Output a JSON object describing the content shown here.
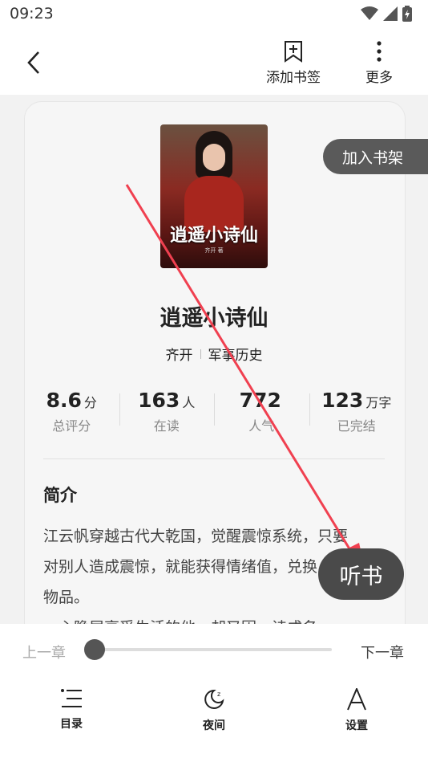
{
  "status_bar": {
    "time": "09:23",
    "icons": [
      "wifi-icon",
      "signal-icon",
      "battery-charging-icon"
    ]
  },
  "top_bar": {
    "back_icon": "chevron-left-icon",
    "bookmark_label": "添加书签",
    "more_label": "更多"
  },
  "book": {
    "cover_title": "逍遥小诗仙",
    "cover_author": "齐开 著",
    "title": "逍遥小诗仙",
    "author": "齐开",
    "category": "军事历史"
  },
  "shelf_button": "加入书架",
  "stats": [
    {
      "value": "8.6",
      "unit": "分",
      "caption": "总评分"
    },
    {
      "value": "163",
      "unit": "人",
      "caption": "在读"
    },
    {
      "value": "772",
      "unit": "",
      "caption": "人气"
    },
    {
      "value": "123",
      "unit": "万字",
      "caption": "已完结"
    }
  ],
  "intro": {
    "heading": "简介",
    "lines": [
      "江云帆穿越古代大乾国，觉醒震惊系统，只要",
      "对别人造成震惊，就能获得情绪值，兑换",
      "物品。",
      "一心隐居享受生活的他，却又因一诗成名"
    ]
  },
  "listen_button": "听书",
  "reader": {
    "prev_label": "上一章",
    "next_label": "下一章",
    "progress": 0.0
  },
  "bottom_nav": [
    {
      "label": "目录",
      "icon": "list-icon"
    },
    {
      "label": "夜间",
      "icon": "moon-icon"
    },
    {
      "label": "设置",
      "icon": "font-settings-icon"
    }
  ],
  "colors": {
    "annotation_arrow": "#f04050",
    "dark_button": "#555555"
  }
}
